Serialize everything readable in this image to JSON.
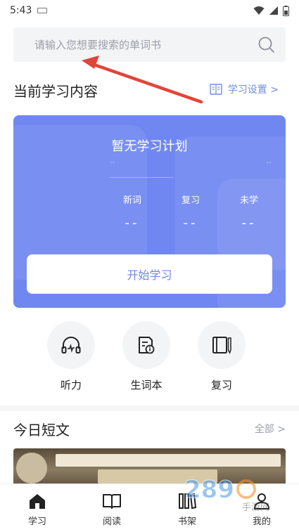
{
  "status_bar": {
    "time": "5:43"
  },
  "search": {
    "placeholder": "请输入您想要搜索的单词书"
  },
  "current_section": {
    "title": "当前学习内容",
    "settings_label": "学习设置 >"
  },
  "plan": {
    "title": "暂无学习计划",
    "dash_left": "--",
    "dash_right": "--",
    "stats": [
      {
        "label": "新词",
        "value": "--"
      },
      {
        "label": "复习",
        "value": "--"
      },
      {
        "label": "未学",
        "value": "--"
      }
    ],
    "start_button": "开始学习"
  },
  "quick_actions": [
    {
      "label": "听力",
      "icon": "headphones-icon"
    },
    {
      "label": "生词本",
      "icon": "wordbook-icon"
    },
    {
      "label": "复习",
      "icon": "review-book-icon"
    }
  ],
  "today": {
    "title": "今日短文",
    "all_label": "全部 >"
  },
  "tabs": [
    {
      "label": "学习",
      "icon": "home-icon"
    },
    {
      "label": "阅读",
      "icon": "open-book-icon"
    },
    {
      "label": "书架",
      "icon": "bookshelf-icon"
    },
    {
      "label": "我的",
      "icon": "person-icon"
    }
  ],
  "colors": {
    "card": "#7087f1",
    "accent": "#6f8fde",
    "annotation_arrow": "#e0453a"
  }
}
